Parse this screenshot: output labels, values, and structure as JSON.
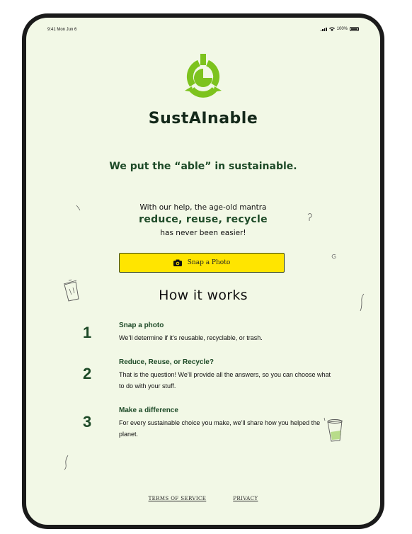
{
  "status_bar": {
    "time": "9:41  Mon Jun 6",
    "battery": "100%"
  },
  "app": {
    "name": "SustAInable",
    "tagline": "We put the “able” in sustainable."
  },
  "intro": {
    "line1": "With our help, the age-old mantra",
    "mantra": "reduce, reuse, recycle",
    "line2": "has never been easier!"
  },
  "snap_button": {
    "label": "Snap a Photo",
    "icon": "camera-icon"
  },
  "how_it_works": {
    "heading": "How it works",
    "steps": [
      {
        "number": "1",
        "title": "Snap a photo",
        "desc": "We’ll determine if it’s reusable, recyclable, or trash."
      },
      {
        "number": "2",
        "title": "Reduce, Reuse, or Recycle?",
        "desc": "That is the question! We’ll provide all the answers, so you can choose what to do with your stuff."
      },
      {
        "number": "3",
        "title": "Make a difference",
        "desc": "For every sustainable choice you make, we’ll share how you helped the planet."
      }
    ]
  },
  "footer": {
    "terms": "TERMS OF SERVICE",
    "privacy": "PRIVACY"
  },
  "colors": {
    "background": "#f2f8e6",
    "accent_green": "#7dc31e",
    "dark_green": "#1d4a27",
    "button_yellow": "#ffe500"
  }
}
